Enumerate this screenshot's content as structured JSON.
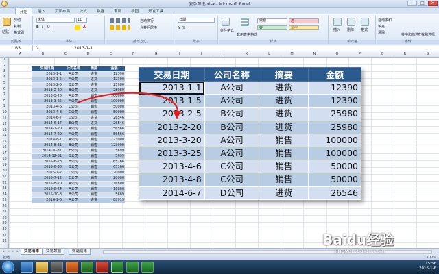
{
  "window": {
    "title": "复杂筛选.xlsx - Microsoft Excel"
  },
  "ribbon_tabs": [
    "开始",
    "插入",
    "页面布局",
    "公式",
    "数据",
    "审阅",
    "视图",
    "开发工具"
  ],
  "ribbon": {
    "paste": "粘贴",
    "cut": "剪切",
    "copy": "复制",
    "format_painter": "格式刷",
    "font_name": "宋体",
    "font_size": "11",
    "wrap": "自动换行",
    "merge": "合并后居中",
    "number_format": "日期",
    "cond_format": "条件格式",
    "table_format": "套用表格格式",
    "style_normal": "常规",
    "style_bad": "差",
    "style_good": "好",
    "style_neutral": "适中",
    "insert": "插入",
    "delete": "删除",
    "format": "格式",
    "autosum": "自动求和",
    "fill": "填充",
    "clear": "清除",
    "sort_filter": "排序和筛选",
    "find_select": "查找和选择",
    "groups": [
      "剪贴板",
      "字体",
      "对齐方式",
      "数字",
      "样式",
      "单元格",
      "编辑"
    ]
  },
  "namebox": "B3",
  "formula": "2013-1-1",
  "col_letters": [
    "A",
    "B",
    "C",
    "D",
    "E",
    "F",
    "G",
    "H",
    "I",
    "J",
    "K",
    "L",
    "M",
    "N",
    "O",
    "P",
    "Q",
    "R",
    "S"
  ],
  "row_numbers": [
    "1",
    "2",
    "3",
    "4",
    "5",
    "6",
    "7",
    "8",
    "9",
    "10",
    "11",
    "12",
    "13",
    "14",
    "15",
    "16",
    "17",
    "18",
    "19",
    "20",
    "21",
    "22",
    "23",
    "24",
    "25",
    "26",
    "27",
    "28",
    "29",
    "30",
    "31",
    "32"
  ],
  "small_table": {
    "headers": [
      "交易日期",
      "公司名称",
      "摘要",
      "金额"
    ],
    "rows": [
      [
        "2013-1-1",
        "A公司",
        "进货",
        "12390"
      ],
      [
        "2013-1-5",
        "A公司",
        "进货",
        "12390"
      ],
      [
        "2013-2-5",
        "B公司",
        "进货",
        "25980"
      ],
      [
        "2013-2-20",
        "B公司",
        "进货",
        "25980"
      ],
      [
        "2013-3-20",
        "A公司",
        "销售",
        "100000"
      ],
      [
        "2013-3-25",
        "A公司",
        "销售",
        "100000"
      ],
      [
        "2013-4-6",
        "C公司",
        "销售",
        "50000"
      ],
      [
        "2013-4-8",
        "C公司",
        "销售",
        "50000"
      ],
      [
        "2014-6-7",
        "D公司",
        "进货",
        "26546"
      ],
      [
        "2014-6-17",
        "E公司",
        "进货",
        "26546"
      ],
      [
        "2014-7-20",
        "A公司",
        "销售",
        "56566"
      ],
      [
        "2014-7-29",
        "A公司",
        "销售",
        "56566"
      ],
      [
        "2014-8-1",
        "A公司",
        "销售",
        "123000"
      ],
      [
        "2014-8-31",
        "B公司",
        "销售",
        "123000"
      ],
      [
        "2014-10-31",
        "E公司",
        "销售",
        "5699"
      ],
      [
        "2014-12-31",
        "B公司",
        "销售",
        "5699"
      ],
      [
        "2015-6-28",
        "B公司",
        "销售",
        "65166"
      ],
      [
        "2015-6-30",
        "B公司",
        "销售",
        "65166"
      ],
      [
        "2015-7-2",
        "C公司",
        "销售",
        "20000"
      ],
      [
        "2015-7-12",
        "C公司",
        "销售",
        "20000"
      ],
      [
        "2015-8-20",
        "A公司",
        "销售",
        "16800"
      ],
      [
        "2015-8-24",
        "A公司",
        "销售",
        "16800"
      ],
      [
        "2015-10-8",
        "B公司",
        "销售",
        "5689"
      ],
      [
        "2016-1-6",
        "A公司",
        "进货",
        "88919"
      ]
    ]
  },
  "big_table": {
    "headers": [
      "交易日期",
      "公司名称",
      "摘要",
      "金额"
    ],
    "rows": [
      [
        "2013-1-1",
        "A公司",
        "进货",
        "12390"
      ],
      [
        "2013-1-5",
        "A公司",
        "进货",
        "12390"
      ],
      [
        "2013-2-5",
        "B公司",
        "进货",
        "25980"
      ],
      [
        "2013-2-20",
        "B公司",
        "进货",
        "25980"
      ],
      [
        "2013-3-20",
        "A公司",
        "销售",
        "100000"
      ],
      [
        "2013-3-25",
        "A公司",
        "销售",
        "100000"
      ],
      [
        "2013-4-6",
        "C公司",
        "销售",
        "50000"
      ],
      [
        "2013-4-8",
        "C公司",
        "销售",
        "50000"
      ],
      [
        "2014-6-7",
        "D公司",
        "进货",
        "26546"
      ]
    ]
  },
  "sheet_tabs": [
    "交易清单",
    "交易数据",
    "筛选结果"
  ],
  "status": {
    "ready": "就绪",
    "zoom": "100%"
  },
  "tray": {
    "time": "15:56",
    "date": "2016-1-6"
  },
  "watermark": {
    "main": "Baidu经验",
    "sub": "jingyan.baidu.com"
  }
}
